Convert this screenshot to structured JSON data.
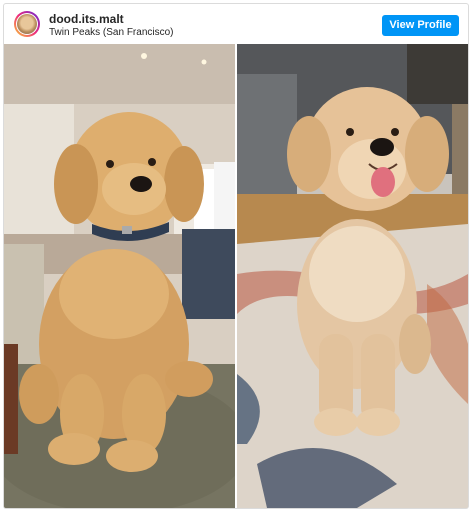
{
  "post": {
    "username": "dood.its.malt",
    "location": "Twin Peaks (San Francisco)",
    "cta_label": "View Profile"
  },
  "colors": {
    "accent": "#0095f6",
    "dog_fur": "#d9ad72",
    "border": "#dbdbdb"
  },
  "media": {
    "left_photo_subject": "goldendoodle-puppy-on-couch",
    "right_photo_subject": "goldendoodle-on-rug"
  }
}
